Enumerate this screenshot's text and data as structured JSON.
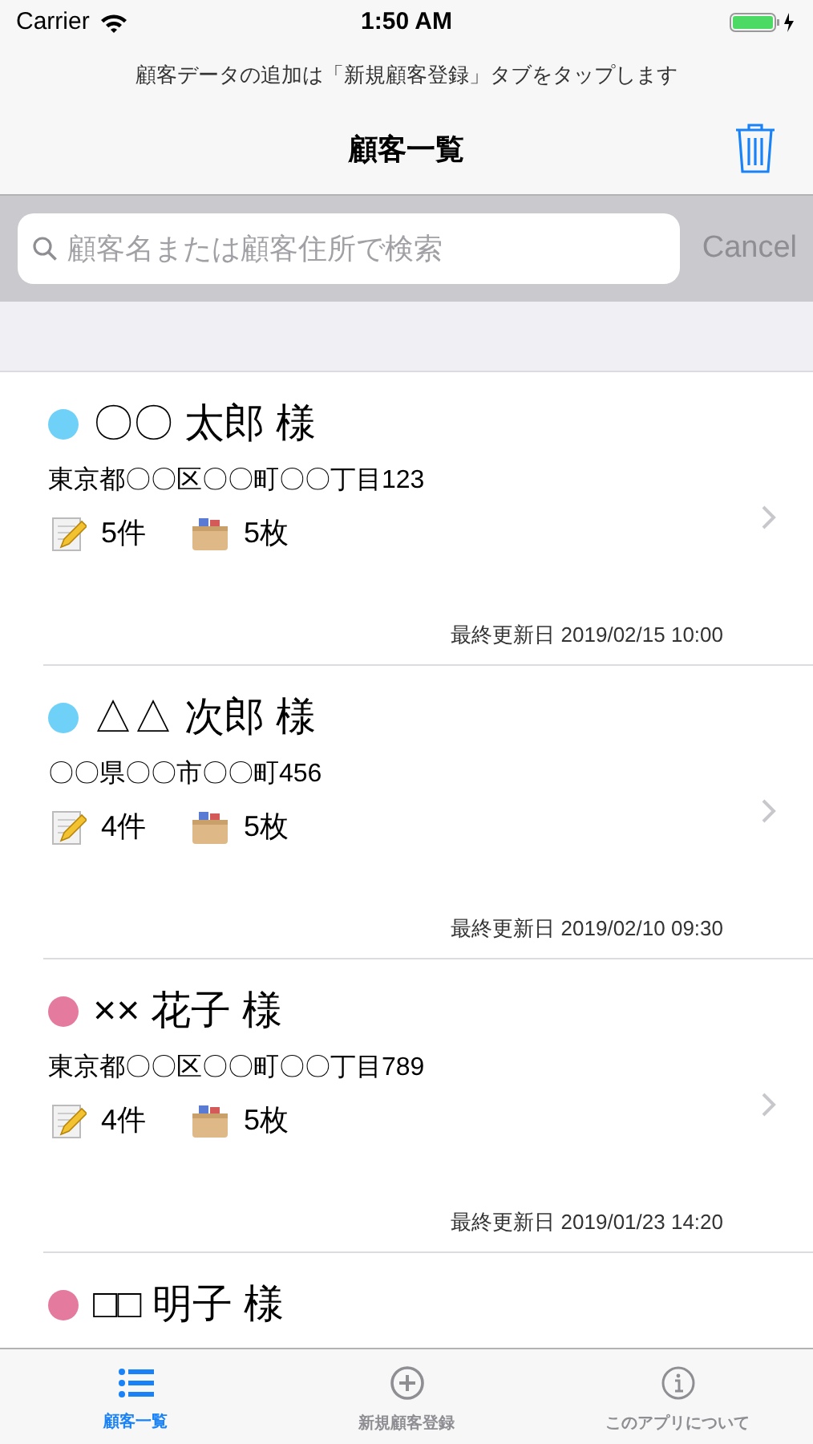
{
  "status_bar": {
    "carrier": "Carrier",
    "time": "1:50 AM"
  },
  "prompt": "顧客データの追加は「新規顧客登録」タブをタップします",
  "nav": {
    "title": "顧客一覧"
  },
  "search": {
    "placeholder": "顧客名または顧客住所で検索",
    "cancel": "Cancel"
  },
  "customers": [
    {
      "name": "〇〇 太郎 様",
      "color": "#6fd0f8",
      "address": "東京都〇〇区〇〇町〇〇丁目123",
      "memos": "5件",
      "cards": "5枚",
      "updated": "最終更新日 2019/02/15 10:00"
    },
    {
      "name": "△△ 次郎 様",
      "color": "#6fd0f8",
      "address": "〇〇県〇〇市〇〇町456",
      "memos": "4件",
      "cards": "5枚",
      "updated": "最終更新日 2019/02/10 09:30"
    },
    {
      "name": "×× 花子 様",
      "color": "#e47a9e",
      "address": "東京都〇〇区〇〇町〇〇丁目789",
      "memos": "4件",
      "cards": "5枚",
      "updated": "最終更新日 2019/01/23 14:20"
    },
    {
      "name": "□□ 明子 様",
      "color": "#e47a9e"
    }
  ],
  "tabs": [
    {
      "label": "顧客一覧",
      "kind": "list",
      "selected": true
    },
    {
      "label": "新規顧客登録",
      "kind": "add",
      "selected": false
    },
    {
      "label": "このアプリについて",
      "kind": "info",
      "selected": false
    }
  ]
}
